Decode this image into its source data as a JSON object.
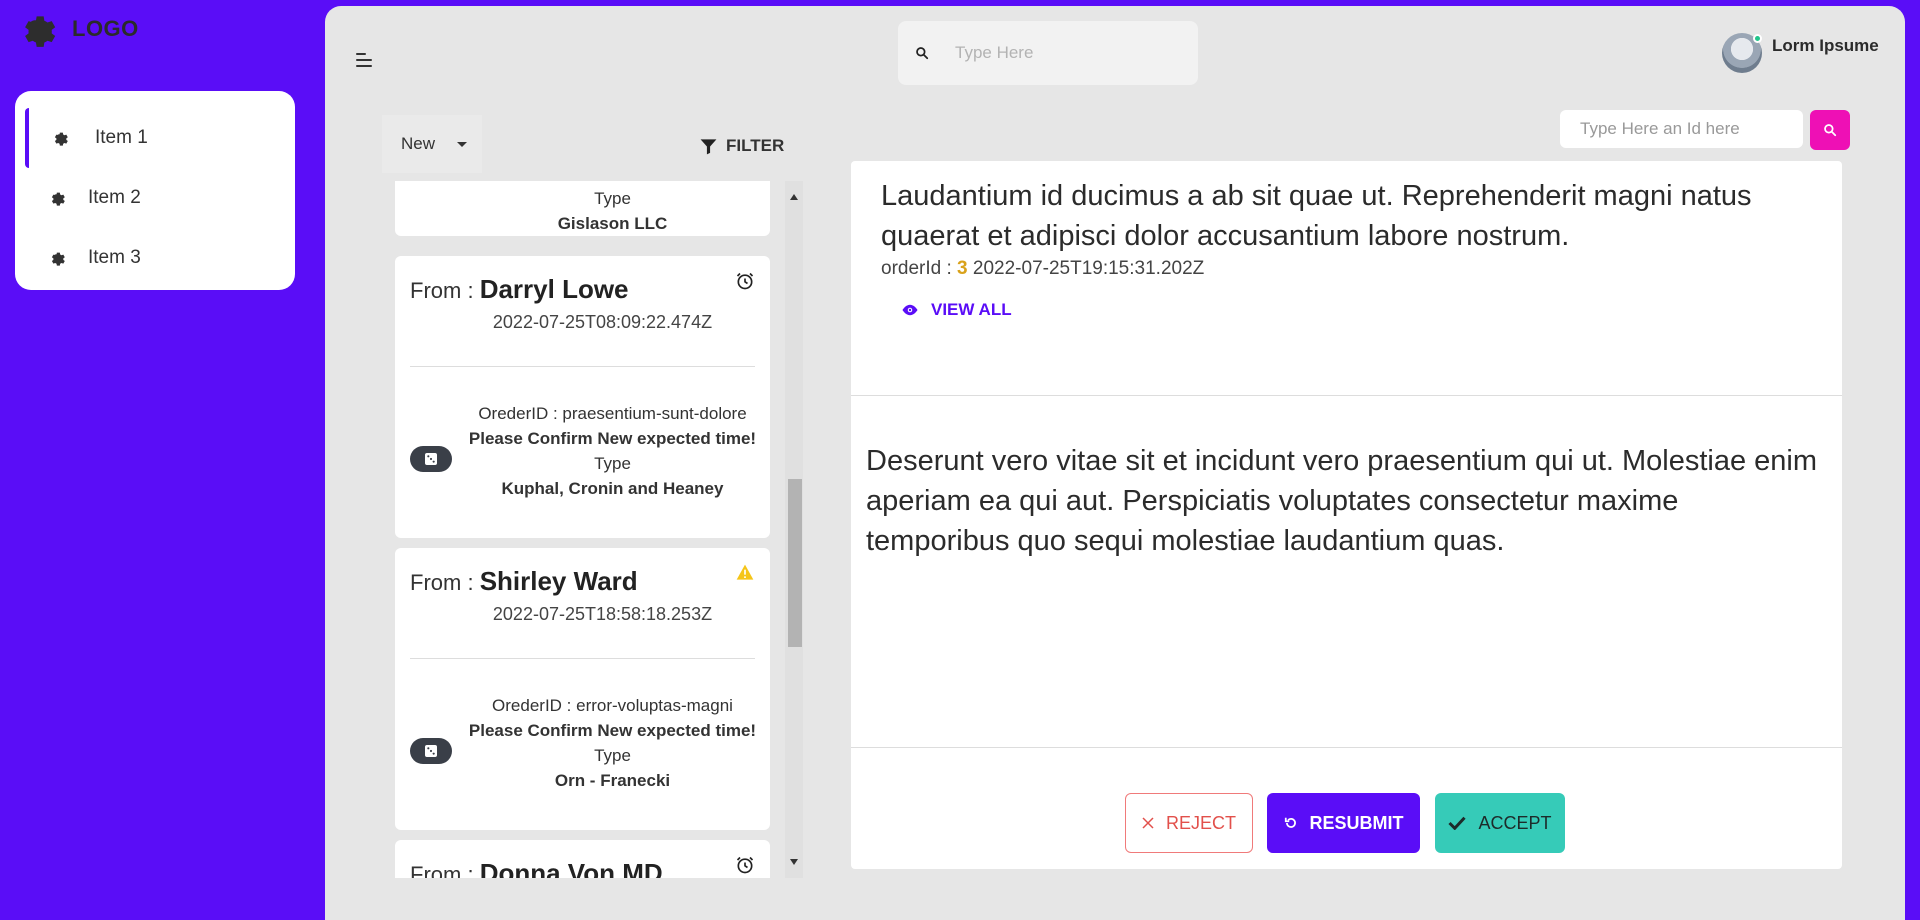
{
  "brand": {
    "logo_text": "LOGO",
    "accent_color": "#5a0df7"
  },
  "sidebar": {
    "items": [
      {
        "label": "Item 1",
        "active": true
      },
      {
        "label": "Item 2",
        "active": false
      },
      {
        "label": "Item 3",
        "active": false
      }
    ]
  },
  "header": {
    "search_placeholder": "Type Here",
    "user_name": "Lorm Ipsume",
    "user_status": "online"
  },
  "list": {
    "status_value": "New",
    "filter_label": "FILTER",
    "partial_top": {
      "type_label": "Type",
      "type_value": "Gislason LLC"
    },
    "cards": [
      {
        "from_label": "From :",
        "from_name": "Darryl Lowe",
        "timestamp": "2022-07-25T08:09:22.474Z",
        "order_line": "OrederID : praesentium-sunt-dolore",
        "message": "Please Confirm New expected time!",
        "type_label": "Type",
        "type_value": "Kuphal, Cronin and Heaney",
        "status_icon": "alarm-clock-icon"
      },
      {
        "from_label": "From :",
        "from_name": "Shirley Ward",
        "timestamp": "2022-07-25T18:58:18.253Z",
        "order_line": "OrederID : error-voluptas-magni",
        "message": "Please Confirm New expected time!",
        "type_label": "Type",
        "type_value": "Orn - Franecki",
        "status_icon": "warning-icon"
      },
      {
        "from_label": "From :",
        "from_name": "Donna Von MD",
        "status_icon": "alarm-clock-icon"
      }
    ]
  },
  "detail": {
    "id_search_placeholder": "Type Here an Id here",
    "title": "Laudantium id ducimus a ab sit quae ut. Reprehenderit magni natus quaerat et adipisci dolor accusantium labore nostrum.",
    "order_label": "orderId :",
    "order_id": "3",
    "order_timestamp": "2022-07-25T19:15:31.202Z",
    "view_all_label": "VIEW ALL",
    "body": "Deserunt vero vitae sit et incidunt vero praesentium qui ut. Molestiae enim aperiam ea qui aut. Perspiciatis voluptates consectetur maxime temporibus quo sequi molestiae laudantium quas.",
    "actions": {
      "reject_label": "REJECT",
      "resubmit_label": "RESUBMIT",
      "accept_label": "ACCEPT"
    }
  },
  "colors": {
    "background": "#5a0df7",
    "panel": "#e6e6e6",
    "pink_button": "#ee10b5",
    "accept": "#36cbb8",
    "reject": "#e2504b",
    "order_number": "#d9a21b",
    "warning": "#f5c518"
  }
}
